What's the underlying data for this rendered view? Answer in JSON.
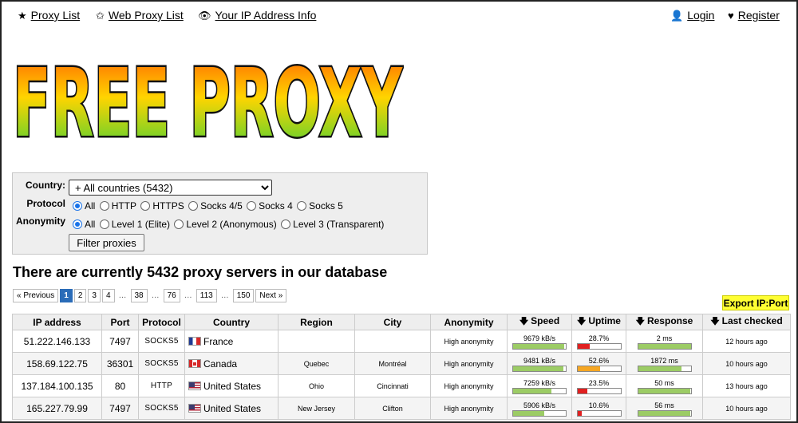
{
  "nav": {
    "proxy_list": "Proxy List",
    "web_proxy_list": "Web Proxy List",
    "ip_info": "Your IP Address Info",
    "login": "Login",
    "register": "Register"
  },
  "logo": {
    "text": "FREE PROXY"
  },
  "filter": {
    "country_label": "Country:",
    "country_value": "+ All countries (5432)",
    "protocol_label": "Protocol",
    "protocol_options": [
      "All",
      "HTTP",
      "HTTPS",
      "Socks 4/5",
      "Socks 4",
      "Socks 5"
    ],
    "anonymity_label": "Anonymity",
    "anonymity_options": [
      "All",
      "Level 1 (Elite)",
      "Level 2 (Anonymous)",
      "Level 3 (Transparent)"
    ],
    "button": "Filter proxies"
  },
  "heading": "There are currently 5432 proxy servers in our database",
  "pager": {
    "prev": "« Previous",
    "pages": [
      "1",
      "2",
      "3",
      "4",
      "38",
      "76",
      "113",
      "150"
    ],
    "next": "Next »",
    "ellipsis": "…"
  },
  "export": "Export IP:Port",
  "table": {
    "headers": {
      "ip": "IP address",
      "port": "Port",
      "protocol": "Protocol",
      "country": "Country",
      "region": "Region",
      "city": "City",
      "anonymity": "Anonymity",
      "speed": "Speed",
      "uptime": "Uptime",
      "response": "Response",
      "last_checked": "Last checked"
    },
    "rows": [
      {
        "ip": "51.222.146.133",
        "port": "7497",
        "protocol": "SOCKS5",
        "country": "France",
        "region": "",
        "city": "",
        "anonymity": "High anonymity",
        "speed": "9679 kB/s",
        "speed_pct": 0.97,
        "uptime": "28.7%",
        "uptime_pct": 0.287,
        "response": "2 ms",
        "response_pct": 1.0,
        "last_checked": "12 hours ago"
      },
      {
        "ip": "158.69.122.75",
        "port": "36301",
        "protocol": "SOCKS5",
        "country": "Canada",
        "region": "Quebec",
        "city": "Montréal",
        "anonymity": "High anonymity",
        "speed": "9481 kB/s",
        "speed_pct": 0.95,
        "uptime": "52.6%",
        "uptime_pct": 0.526,
        "response": "1872 ms",
        "response_pct": 0.82,
        "last_checked": "10 hours ago"
      },
      {
        "ip": "137.184.100.135",
        "port": "80",
        "protocol": "HTTP",
        "country": "United States",
        "region": "Ohio",
        "city": "Cincinnati",
        "anonymity": "High anonymity",
        "speed": "7259 kB/s",
        "speed_pct": 0.73,
        "uptime": "23.5%",
        "uptime_pct": 0.235,
        "response": "50 ms",
        "response_pct": 0.99,
        "last_checked": "13 hours ago"
      },
      {
        "ip": "165.227.79.99",
        "port": "7497",
        "protocol": "SOCKS5",
        "country": "United States",
        "region": "New Jersey",
        "city": "Clifton",
        "anonymity": "High anonymity",
        "speed": "5906 kB/s",
        "speed_pct": 0.59,
        "uptime": "10.6%",
        "uptime_pct": 0.106,
        "response": "56 ms",
        "response_pct": 0.99,
        "last_checked": "10 hours ago"
      }
    ]
  },
  "colors": {
    "bar_good": "#9ccc65",
    "bar_mid": "#f5a623",
    "bar_bad": "#e02020",
    "pager_active": "#2a6cb8",
    "export_bg": "#ffff33"
  }
}
